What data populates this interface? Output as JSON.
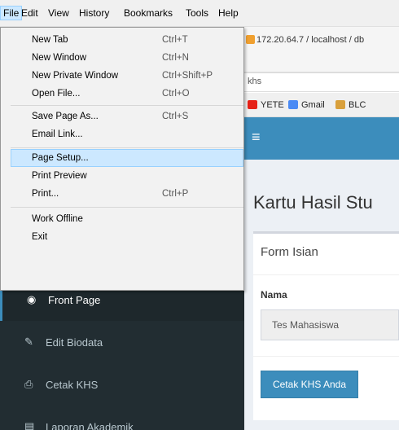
{
  "menubar": {
    "items": [
      "File",
      "Edit",
      "View",
      "History",
      "Bookmarks",
      "Tools",
      "Help"
    ]
  },
  "file_menu": {
    "items": [
      {
        "label": "New Tab",
        "shortcut": "Ctrl+T"
      },
      {
        "label": "New Window",
        "shortcut": "Ctrl+N"
      },
      {
        "label": "New Private Window",
        "shortcut": "Ctrl+Shift+P"
      },
      {
        "label": "Open File...",
        "shortcut": "Ctrl+O"
      },
      {
        "label": "Save Page As...",
        "shortcut": "Ctrl+S"
      },
      {
        "label": "Email Link...",
        "shortcut": ""
      },
      {
        "label": "Page Setup...",
        "shortcut": ""
      },
      {
        "label": "Print Preview",
        "shortcut": ""
      },
      {
        "label": "Print...",
        "shortcut": "Ctrl+P"
      },
      {
        "label": "Work Offline",
        "shortcut": ""
      },
      {
        "label": "Exit",
        "shortcut": ""
      }
    ],
    "highlighted": "Page Setup..."
  },
  "browser": {
    "tab_title": "172.20.64.7 / localhost / db",
    "url": "khs",
    "bookmarks": [
      "YETE",
      "Gmail",
      "BLC"
    ]
  },
  "sidebar": {
    "items": [
      {
        "label": "Front Page",
        "icon": "dashboard-icon",
        "glyph": "◉"
      },
      {
        "label": "Edit Biodata",
        "icon": "edit-icon",
        "glyph": "✎"
      },
      {
        "label": "Cetak KHS",
        "icon": "print-icon",
        "glyph": "⎙"
      },
      {
        "label": "Laporan Akademik",
        "icon": "report-icon",
        "glyph": "▤"
      }
    ]
  },
  "page": {
    "title": "Kartu Hasil Stu",
    "box_title": "Form Isian",
    "field_label": "Nama",
    "field_value": "Tes Mahasiswa",
    "button_label": "Cetak KHS Anda"
  },
  "colors": {
    "accent": "#3c8dbc",
    "sidebar_bg": "#222d32",
    "menu_highlight": "#cce8ff"
  }
}
